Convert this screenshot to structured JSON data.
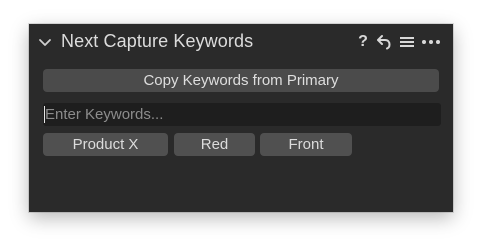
{
  "panel": {
    "title": "Next Capture Keywords",
    "tools": {
      "help": "?",
      "icons": [
        "chevron-down-icon",
        "help-icon",
        "reset-arrow-icon",
        "hamburger-menu-icon",
        "more-options-icon"
      ]
    }
  },
  "copy_button": {
    "label": "Copy Keywords from Primary"
  },
  "keyword_input": {
    "value": "",
    "placeholder": "Enter Keywords..."
  },
  "keywords": [
    "Product X",
    "Red",
    "Front"
  ],
  "colors": {
    "panel_bg": "#2a2a2a",
    "button_bg": "#4b4b4b",
    "input_bg": "#1e1e1e",
    "text": "#dcdcdc"
  }
}
